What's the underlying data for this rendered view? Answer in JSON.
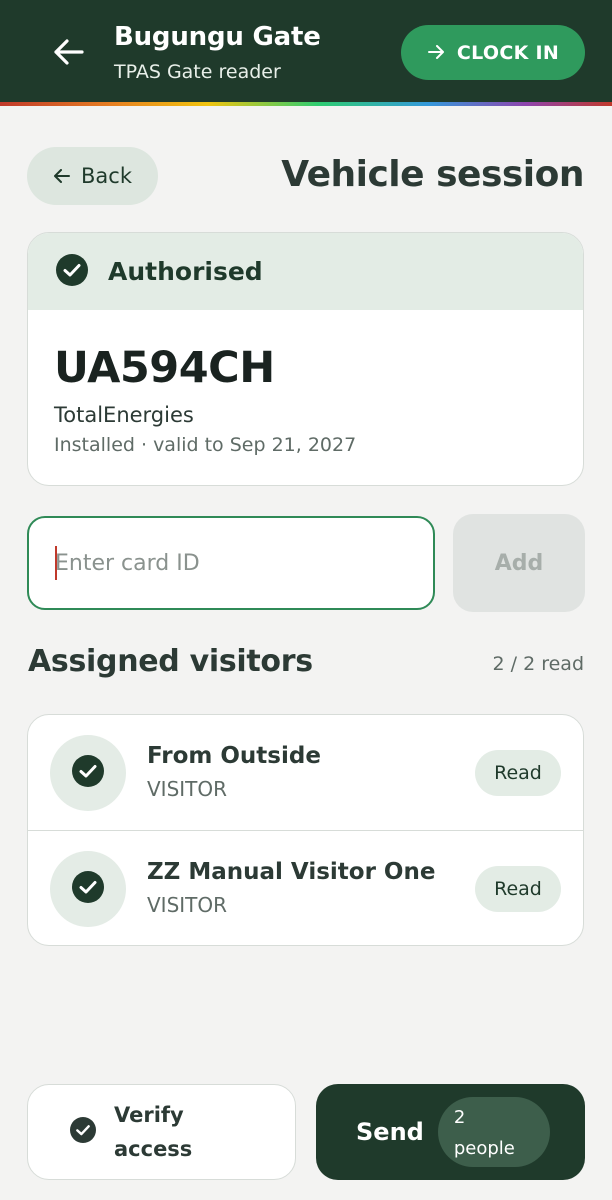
{
  "header": {
    "title": "Bugungu Gate",
    "subtitle": "TPAS Gate reader",
    "clock_in_label": "CLOCK IN"
  },
  "page": {
    "back_label": "Back",
    "title": "Vehicle session"
  },
  "vehicle": {
    "status": "Authorised",
    "plate": "UA594CH",
    "company": "TotalEnergies",
    "validity": "Installed · valid to Sep 21, 2027"
  },
  "card_entry": {
    "placeholder": "Enter card ID",
    "value": "",
    "add_label": "Add"
  },
  "visitors": {
    "title": "Assigned visitors",
    "read_count": "2 / 2 read",
    "items": [
      {
        "name": "From Outside",
        "type": "VISITOR",
        "status": "Read"
      },
      {
        "name": "ZZ Manual Visitor One",
        "type": "VISITOR",
        "status": "Read"
      }
    ]
  },
  "actions": {
    "verify_label": "Verify access",
    "send_label": "Send",
    "people_count": "2",
    "people_label": "people"
  },
  "colors": {
    "header_bg": "#1f3a2b",
    "accent_green": "#2f9a5d",
    "authorised_band": "#e3ece5"
  }
}
